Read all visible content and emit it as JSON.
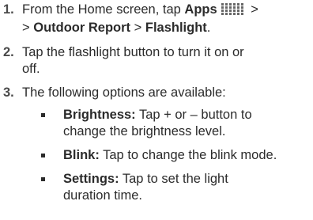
{
  "steps": [
    {
      "num": "1.",
      "line1_pre": "From the Home screen, tap ",
      "line1_bold": "Apps",
      "line1_post": " >",
      "line2_pre": "> ",
      "line2_bold1": "Outdoor Report",
      "line2_mid": " > ",
      "line2_bold2": "Flashlight",
      "line2_post": ".",
      "icon": "apps-grid-icon"
    },
    {
      "num": "2.",
      "line1": "Tap the flashlight button to turn it on or",
      "line2": "off."
    },
    {
      "num": "3.",
      "line1": "The following options are available:"
    }
  ],
  "options": [
    {
      "bold": "Brightness:",
      "line1": " Tap + or – button to",
      "line2": "change the brightness level."
    },
    {
      "bold": "Blink:",
      "line1": " Tap to change the blink mode."
    },
    {
      "bold": "Settings:",
      "line1": " Tap to set the light",
      "line2": "duration time."
    }
  ]
}
